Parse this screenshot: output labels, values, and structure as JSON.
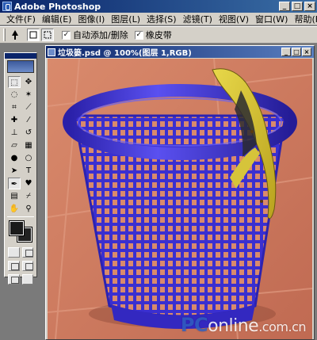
{
  "window": {
    "title": "Adobe Photoshop",
    "minimize": "_",
    "maximize": "□",
    "close": "×"
  },
  "menu": [
    "文件(F)",
    "编辑(E)",
    "图像(I)",
    "图层(L)",
    "选择(S)",
    "滤镜(T)",
    "视图(V)",
    "窗口(W)",
    "帮助(H)"
  ],
  "options": {
    "tool_icon": "pen-icon",
    "auto_add_delete": "自动添加/删除",
    "rubber_band": "橡皮带",
    "auto_add_delete_checked": true,
    "rubber_band_checked": true
  },
  "document": {
    "title": "垃圾篓.psd @ 100%(图层 1,RGB)"
  },
  "watermark": {
    "pc": "PC",
    "online": "online",
    "domain": ".com.cn"
  },
  "colors": {
    "foreground": "#1a1a1a",
    "background": "#222222",
    "canvas": "#c9785e",
    "basket": "#3a2fd0"
  },
  "toolbox": {
    "tools": [
      "marquee-icon",
      "move-icon",
      "lasso-icon",
      "magic-wand-icon",
      "crop-icon",
      "slice-icon",
      "healing-brush-icon",
      "brush-icon",
      "clone-stamp-icon",
      "history-brush-icon",
      "eraser-icon",
      "gradient-icon",
      "blur-icon",
      "dodge-icon",
      "path-selection-icon",
      "type-icon",
      "pen-icon",
      "shape-icon",
      "notes-icon",
      "eyedropper-icon",
      "hand-icon",
      "zoom-icon"
    ]
  }
}
